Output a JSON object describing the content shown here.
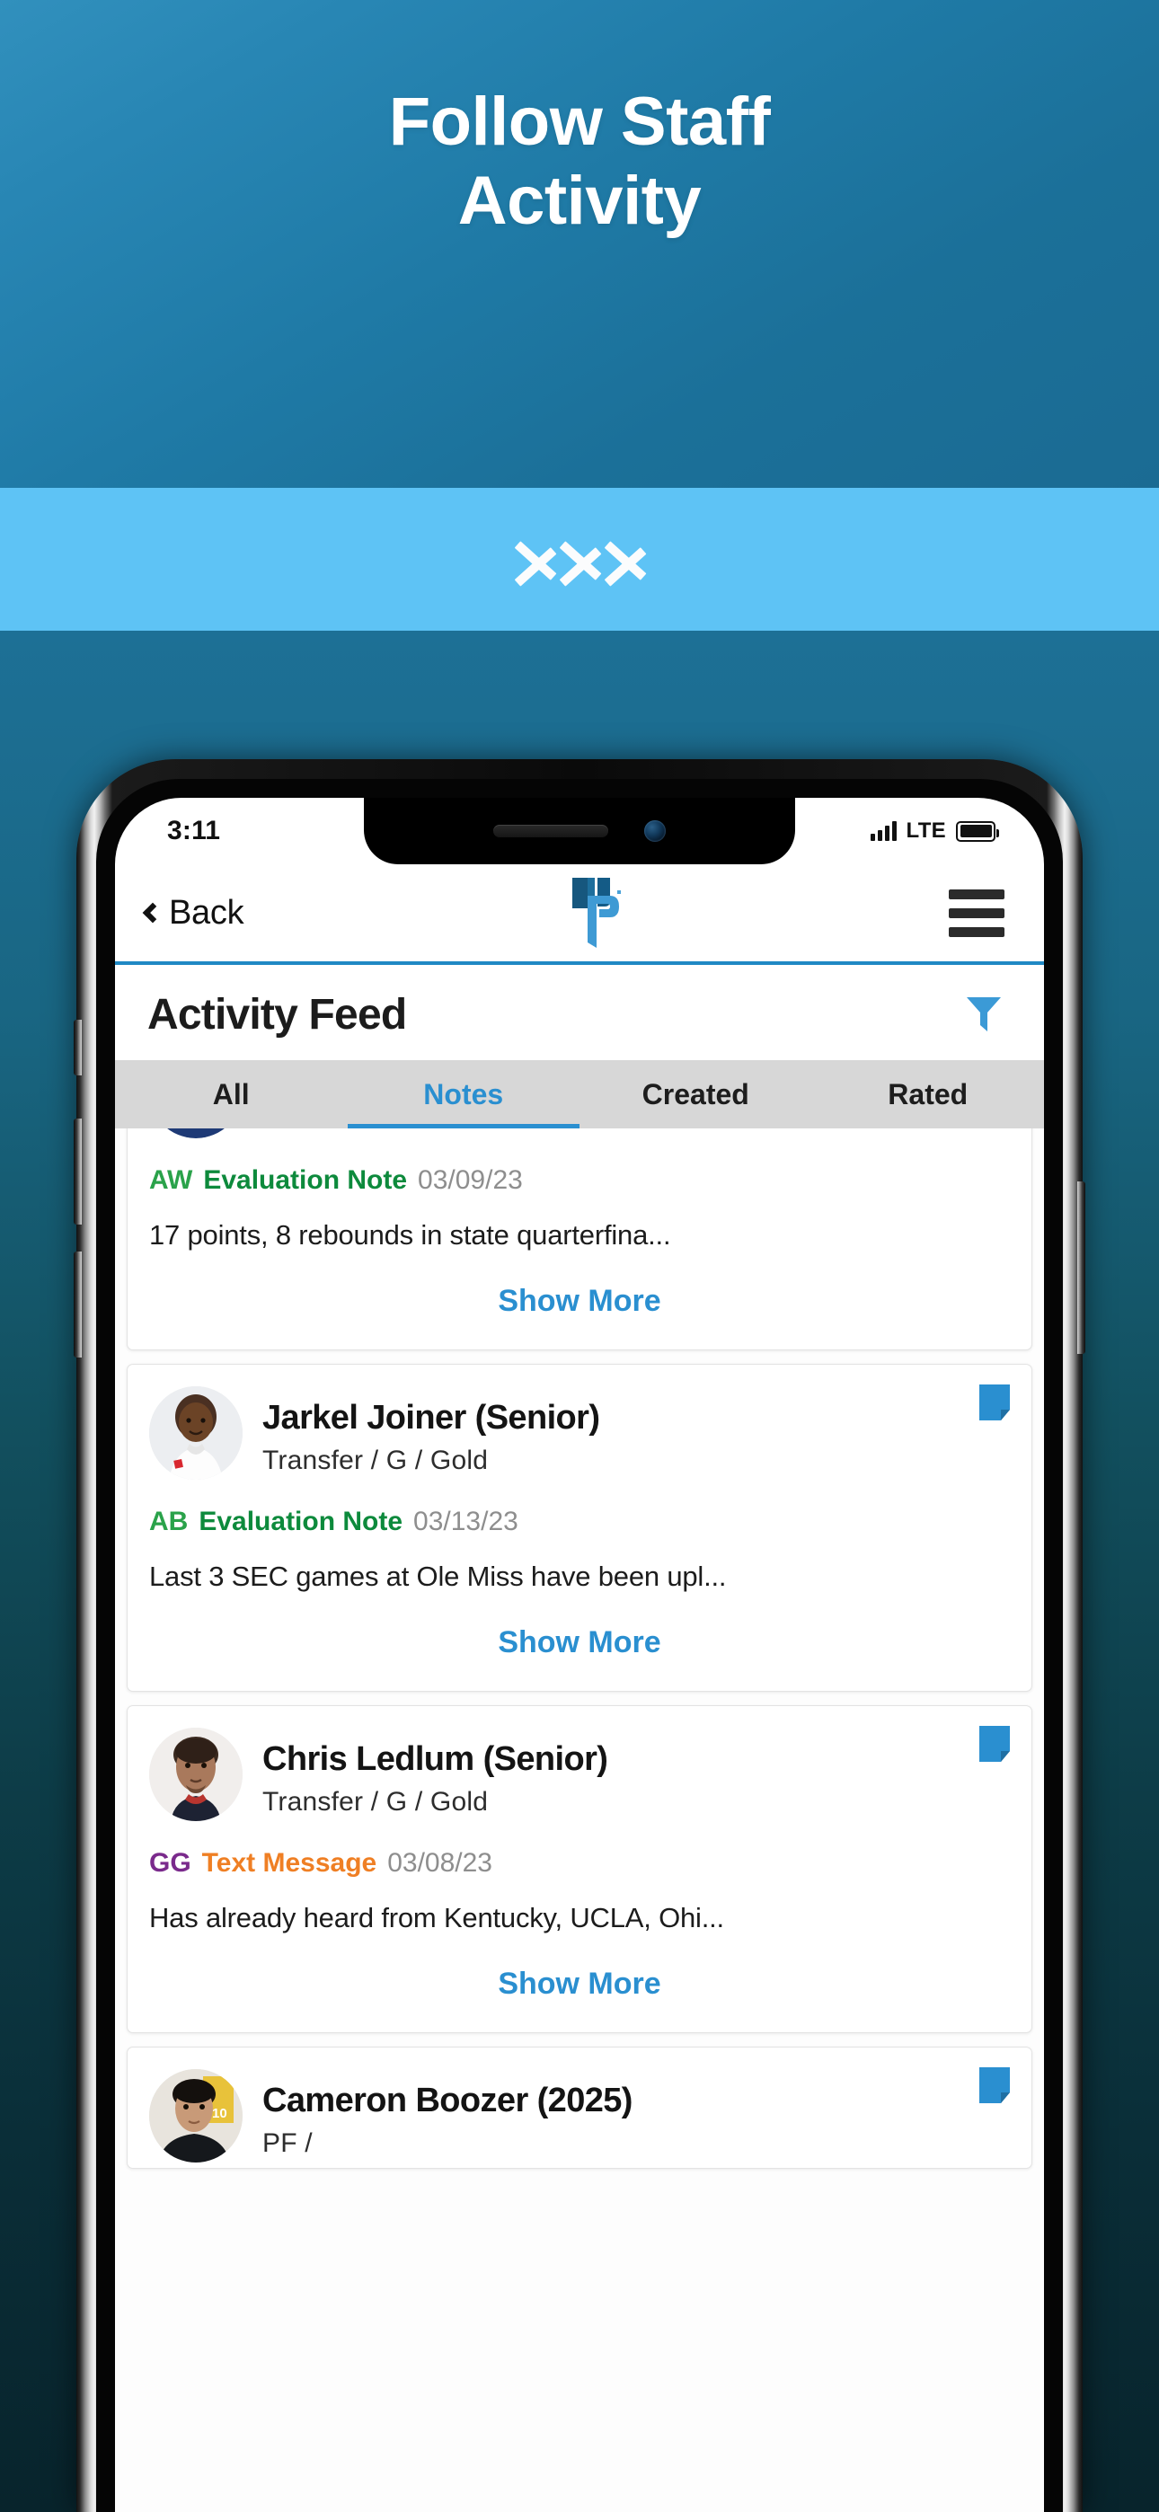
{
  "promo": {
    "headline_line1": "Follow Staff",
    "headline_line2": "Activity",
    "chevron_count": 3,
    "colors": {
      "top_gradient_start": "#3190bd",
      "top_gradient_end": "#1b6b93",
      "band": "#5ec3f5",
      "bottom_gradient_start": "#1d7096",
      "bottom_gradient_end": "#08242c"
    }
  },
  "status_bar": {
    "time": "3:11",
    "network_label": "LTE",
    "signal_bars": 4,
    "battery_full": true
  },
  "nav": {
    "back_label": "Back",
    "logo_name": "prospect-logo",
    "menu_name": "hamburger-menu"
  },
  "page": {
    "title": "Activity Feed",
    "filter_icon": "filter-icon",
    "accent": "#2a8fd0"
  },
  "tabs": [
    {
      "label": "All",
      "active": false
    },
    {
      "label": "Notes",
      "active": true
    },
    {
      "label": "Created",
      "active": false
    },
    {
      "label": "Rated",
      "active": false
    }
  ],
  "show_more_label": "Show More",
  "cards": [
    {
      "clipped": true,
      "player_name": "",
      "player_meta": "",
      "initials": "AW",
      "initials_color": "#2aa24a",
      "note_type": "Evaluation Note",
      "note_type_color": "#0d8a3c",
      "note_date": "03/09/23",
      "note_body": "17 points, 8 rebounds in state quarterfina...",
      "show_more": "Show More",
      "avatar_kind": "team-logo-navy-gold"
    },
    {
      "clipped": false,
      "player_name": "Jarkel Joiner (Senior)",
      "player_meta": "Transfer  /  G  /  Gold",
      "initials": "AB",
      "initials_color": "#2aa24a",
      "note_type": "Evaluation Note",
      "note_type_color": "#0d8a3c",
      "note_date": "03/13/23",
      "note_body": "Last 3 SEC games at Ole Miss have been upl...",
      "show_more": "Show More",
      "avatar_kind": "photo-player-1"
    },
    {
      "clipped": false,
      "player_name": "Chris Ledlum (Senior)",
      "player_meta": "Transfer  /  G  /  Gold",
      "initials": "GG",
      "initials_color": "#7a2a8c",
      "note_type": "Text Message",
      "note_type_color": "#ef7f24",
      "note_date": "03/08/23",
      "note_body": "Has already heard from Kentucky, UCLA, Ohi...",
      "show_more": "Show More",
      "avatar_kind": "photo-player-2"
    },
    {
      "clipped": false,
      "player_name": "Cameron Boozer (2025)",
      "player_meta": "PF /",
      "initials": "",
      "initials_color": "",
      "note_type": "",
      "note_type_color": "",
      "note_date": "",
      "note_body": "",
      "show_more": "",
      "avatar_kind": "photo-player-3"
    }
  ]
}
